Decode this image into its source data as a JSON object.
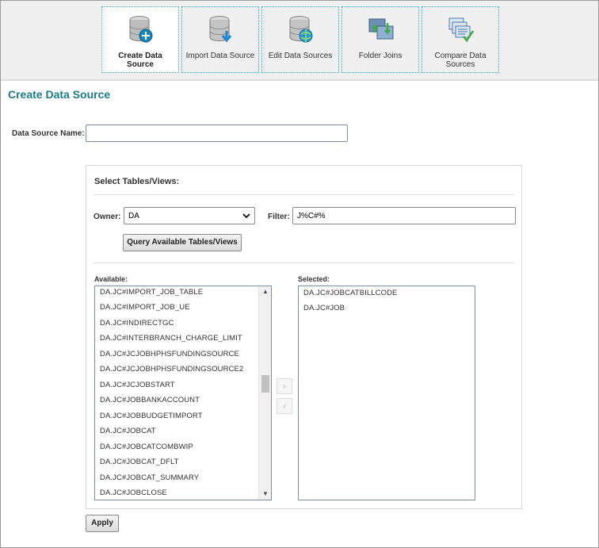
{
  "toolbar": {
    "items": [
      {
        "label": "Create Data Source",
        "icon": "database-create-icon",
        "active": true
      },
      {
        "label": "Import Data Source",
        "icon": "database-import-icon",
        "active": false
      },
      {
        "label": "Edit Data Sources",
        "icon": "database-edit-icon",
        "active": false
      },
      {
        "label": "Folder Joins",
        "icon": "folder-join-icon",
        "active": false
      },
      {
        "label": "Compare Data Sources",
        "icon": "compare-icon",
        "active": false
      }
    ]
  },
  "page": {
    "title": "Create Data Source",
    "data_source_name_label": "Data Source Name:",
    "data_source_name_value": ""
  },
  "tables": {
    "title": "Select Tables/Views:",
    "owner_label": "Owner:",
    "owner_value": "DA",
    "filter_label": "Filter:",
    "filter_value": "J%C#%",
    "query_button": "Query Available Tables/Views",
    "available_label": "Available:",
    "selected_label": "Selected:",
    "available_items": [
      "DA.JC#IMPORT_JOB_TABLE",
      "DA.JC#IMPORT_JOB_UE",
      "DA.JC#INDIRECTGC",
      "DA.JC#INTERBRANCH_CHARGE_LIMIT",
      "DA.JC#JCJOBHPHSFUNDINGSOURCE",
      "DA.JC#JCJOBHPHSFUNDINGSOURCE2",
      "DA.JC#JCJOBSTART",
      "DA.JC#JOBBANKACCOUNT",
      "DA.JC#JOBBUDGETIMPORT",
      "DA.JC#JOBCAT",
      "DA.JC#JOBCATCOMBWIP",
      "DA.JC#JOBCAT_DFLT",
      "DA.JC#JOBCAT_SUMMARY",
      "DA.JC#JOBCLOSE"
    ],
    "selected_items": [
      "DA.JC#JOBCATBILLCODE",
      "DA.JC#JOB"
    ],
    "move_right": "›",
    "move_left": "‹"
  },
  "apply_button": "Apply",
  "colors": {
    "accent": "#1c7c87",
    "toolbar_bg": "#f0f0f0",
    "tile_border": "#2bb3c9"
  }
}
